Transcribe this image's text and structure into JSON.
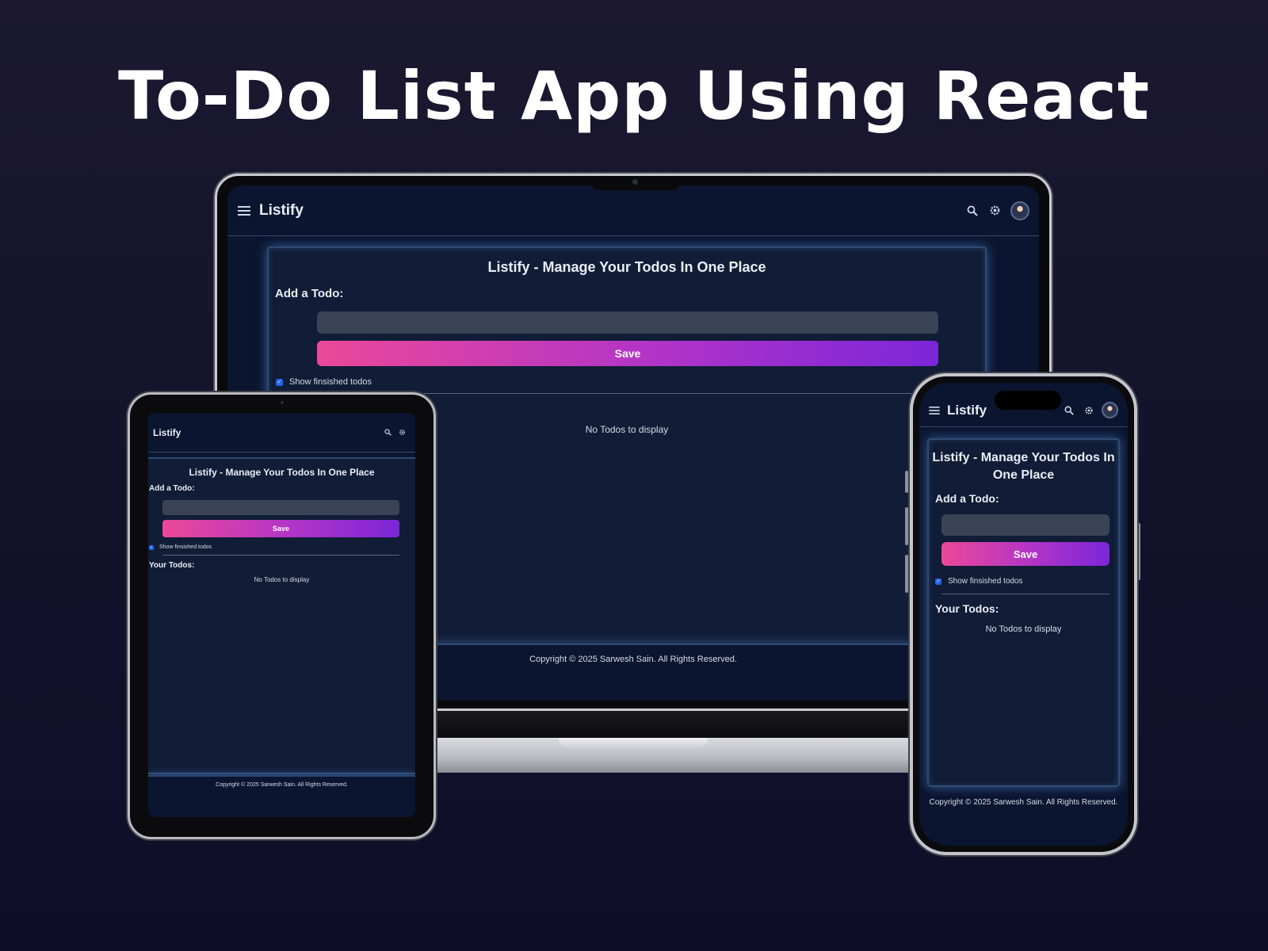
{
  "hero": {
    "title": "To-Do List App Using React"
  },
  "app": {
    "brand": "Listify",
    "card_title": "Listify - Manage Your Todos In One Place",
    "add_label": "Add a Todo:",
    "input_value": "",
    "save_label": "Save",
    "show_finished_label": "Show finsished todos",
    "your_todos_label": "Your Todos:",
    "empty_message": "No Todos to display",
    "footer": "Copyright © 2025 Sarwesh Sain. All Rights Reserved."
  },
  "icons": {
    "menu": "menu-icon",
    "search": "search-icon",
    "settings": "gear-icon",
    "avatar": "avatar",
    "checkbox": "checkbox-checked-icon"
  },
  "colors": {
    "background": "#1b1830",
    "app_bg": "#0b1530",
    "card_bg": "#111c36",
    "card_border": "#2f4b73",
    "input_bg": "#3a4356",
    "save_gradient_start": "#ec4899",
    "save_gradient_end": "#7c26d9",
    "checkbox": "#2563eb"
  }
}
